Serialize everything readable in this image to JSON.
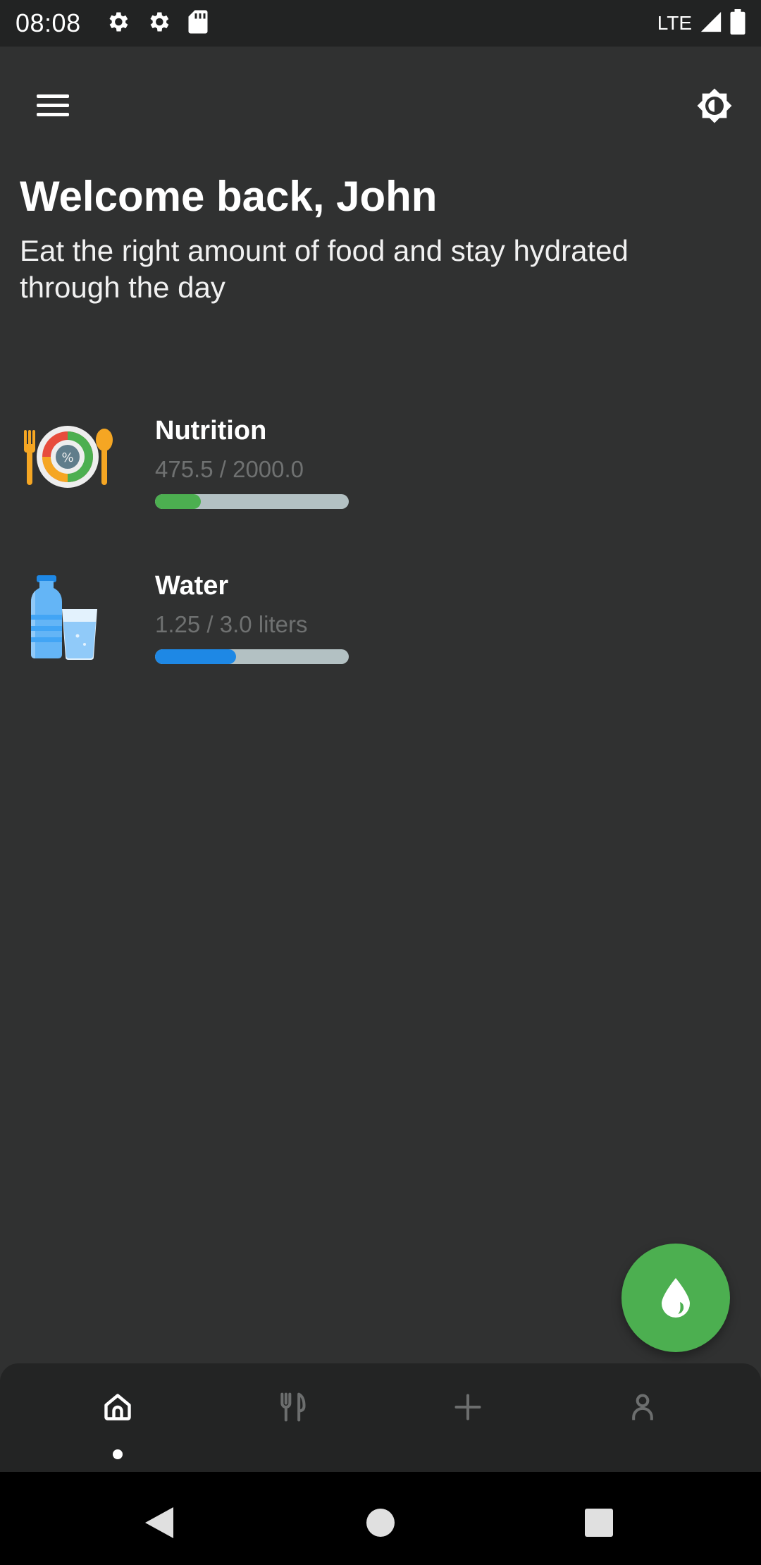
{
  "status_bar": {
    "time": "08:08",
    "network": "LTE"
  },
  "app_bar": {
    "menu_icon": "hamburger-menu-icon",
    "theme_icon": "brightness-icon"
  },
  "header": {
    "title": "Welcome back, John",
    "subtitle": "Eat the right amount of food and stay hydrated through the day"
  },
  "stats": {
    "nutrition": {
      "title": "Nutrition",
      "value": "475.5 / 2000.0",
      "progress": 0.238,
      "color": "#4caf50"
    },
    "water": {
      "title": "Water",
      "value": "1.25 / 3.0 liters",
      "progress": 0.417,
      "color": "#1e88e5"
    }
  },
  "fab": {
    "icon": "water-drop-icon",
    "color": "#4caf50"
  },
  "bottom_nav": {
    "items": [
      {
        "icon": "home-icon",
        "active": true
      },
      {
        "icon": "utensils-icon",
        "active": false
      },
      {
        "icon": "plus-icon",
        "active": false
      },
      {
        "icon": "person-icon",
        "active": false
      }
    ]
  },
  "system_nav": {
    "back_icon": "back-triangle-icon",
    "home_icon": "home-circle-icon",
    "recents_icon": "recents-square-icon"
  }
}
